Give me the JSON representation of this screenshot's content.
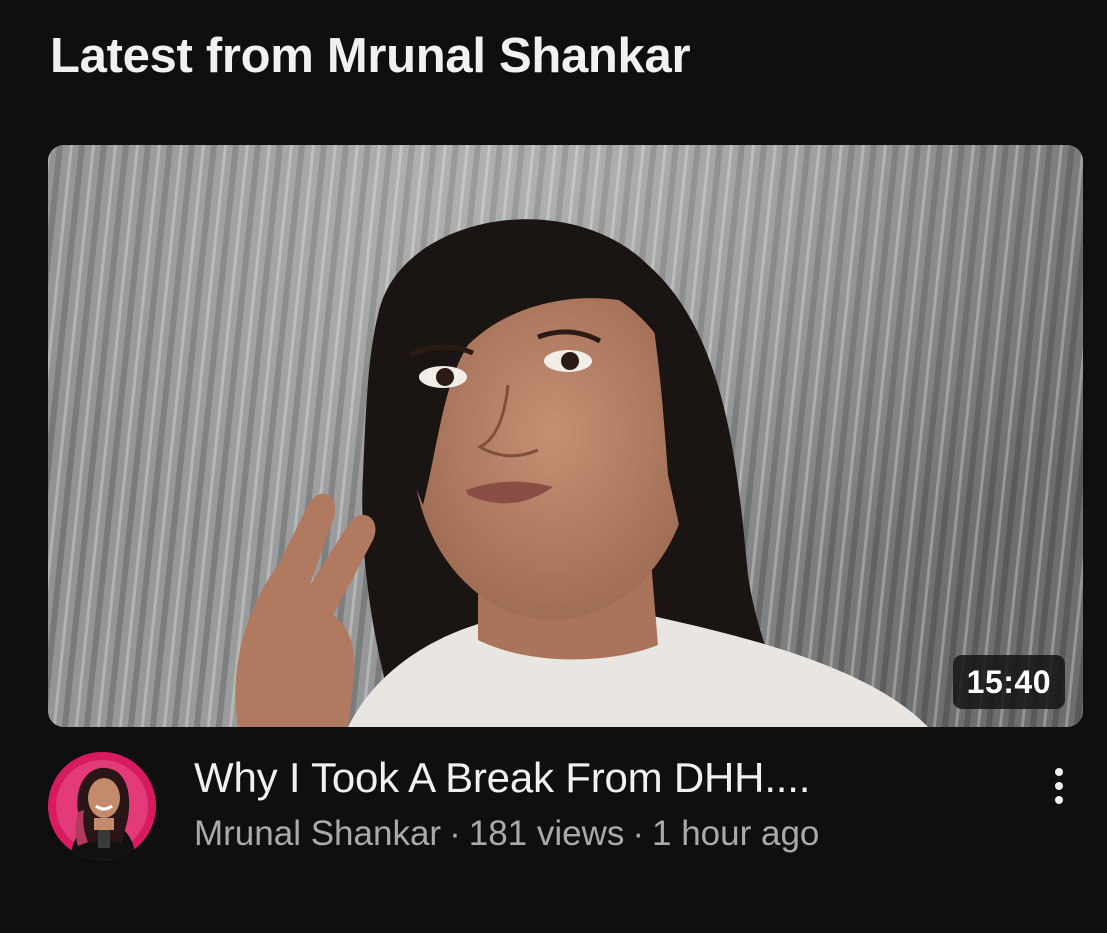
{
  "section": {
    "title": "Latest from Mrunal Shankar"
  },
  "video": {
    "duration": "15:40",
    "title": "Why I Took A Break From DHH....",
    "channel": "Mrunal Shankar",
    "separator": "·",
    "views": "181 views",
    "age": "1 hour ago"
  },
  "icons": {
    "more": "more-vertical-icon"
  },
  "colors": {
    "background": "#0f0f0f",
    "text_primary": "#f1f1f1",
    "text_secondary": "#aaaaaa",
    "avatar_ring": "#d81b60"
  }
}
